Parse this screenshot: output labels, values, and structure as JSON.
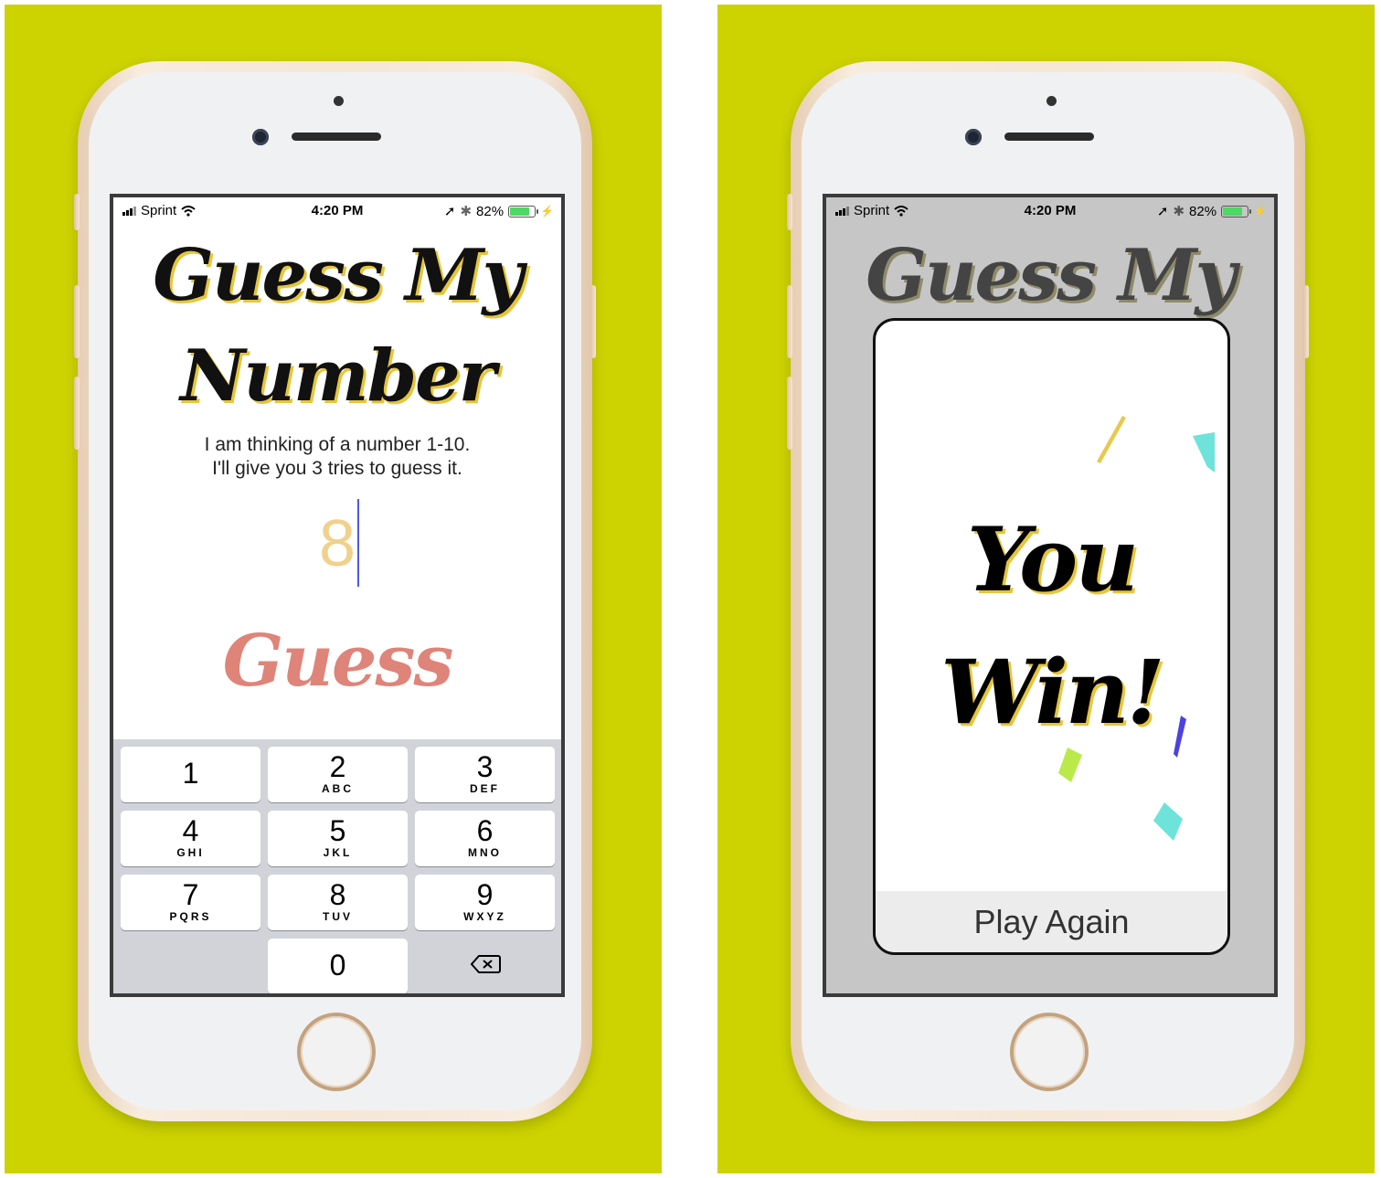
{
  "colors": {
    "panel_bg": "#cdd300",
    "title_shadow": "#e7c53b",
    "guess_button": "#df8479",
    "input_text": "#f0d18c",
    "caret": "#4d5ae0",
    "battery": "#4cd964"
  },
  "left_phone": {
    "status": {
      "carrier": "Sprint",
      "time": "4:20 PM",
      "battery": "82%",
      "battery_level": 0.82
    },
    "title_line1": "Guess My",
    "title_line2": "Number",
    "subtitle_line1": "I am thinking of a number 1-10.",
    "subtitle_line2": "I'll give you 3 tries to guess it.",
    "input_value": "8",
    "guess_button": "Guess",
    "keypad": [
      {
        "num": "1",
        "letters": ""
      },
      {
        "num": "2",
        "letters": "ABC"
      },
      {
        "num": "3",
        "letters": "DEF"
      },
      {
        "num": "4",
        "letters": "GHI"
      },
      {
        "num": "5",
        "letters": "JKL"
      },
      {
        "num": "6",
        "letters": "MNO"
      },
      {
        "num": "7",
        "letters": "PQRS"
      },
      {
        "num": "8",
        "letters": "TUV"
      },
      {
        "num": "9",
        "letters": "WXYZ"
      },
      {
        "num": "0",
        "letters": ""
      }
    ],
    "backspace_icon": "backspace-icon"
  },
  "right_phone": {
    "status": {
      "carrier": "Sprint",
      "time": "4:20 PM",
      "battery": "82%",
      "battery_level": 0.82
    },
    "title_line1": "Guess My",
    "win_line1": "You",
    "win_line2": "Win!",
    "play_again": "Play Again"
  }
}
